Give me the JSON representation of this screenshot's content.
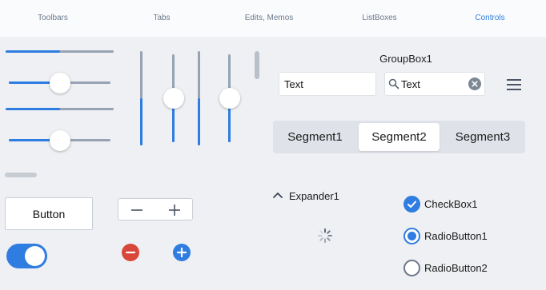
{
  "tabs": [
    {
      "label": "Toolbars",
      "active": false
    },
    {
      "label": "Tabs",
      "active": false
    },
    {
      "label": "Edits, Memos",
      "active": false
    },
    {
      "label": "ListBoxes",
      "active": false
    },
    {
      "label": "Controls",
      "active": true
    }
  ],
  "colors": {
    "accent": "#2f7de1",
    "track": "#97a3b4",
    "delete": "#d9473a",
    "add": "#2f7de1"
  },
  "sliders": {
    "horizontal": [
      {
        "value": 0.5,
        "style": "progress"
      },
      {
        "value": 0.5,
        "style": "thumb"
      },
      {
        "value": 0.5,
        "style": "progress"
      },
      {
        "value": 0.5,
        "style": "thumb"
      }
    ],
    "vertical": [
      {
        "value": 0.5,
        "style": "progress"
      },
      {
        "value": 0.5,
        "style": "thumb"
      },
      {
        "value": 0.5,
        "style": "progress"
      },
      {
        "value": 0.5,
        "style": "thumb"
      }
    ]
  },
  "groupbox": {
    "title": "GroupBox1",
    "edit_value": "Text",
    "search_value": "Text",
    "search_icon": "search-icon",
    "clear_icon": "clear-icon",
    "menu_icon": "hamburger-menu-icon"
  },
  "segments": {
    "items": [
      "Segment1",
      "Segment2",
      "Segment3"
    ],
    "selected": 1
  },
  "button": {
    "label": "Button"
  },
  "stepper": {
    "minus_icon": "minus-icon",
    "plus_icon": "plus-icon"
  },
  "toggle": {
    "on": true
  },
  "delete_icon": "delete-circle-icon",
  "add_icon": "add-circle-icon",
  "expander": {
    "label": "Expander1",
    "icon": "chevron-up-icon",
    "expanded": true
  },
  "activity_indicator": "spinner-icon",
  "checkbox": {
    "label": "CheckBox1",
    "checked": true
  },
  "radios": [
    {
      "label": "RadioButton1",
      "checked": true
    },
    {
      "label": "RadioButton2",
      "checked": false
    }
  ]
}
